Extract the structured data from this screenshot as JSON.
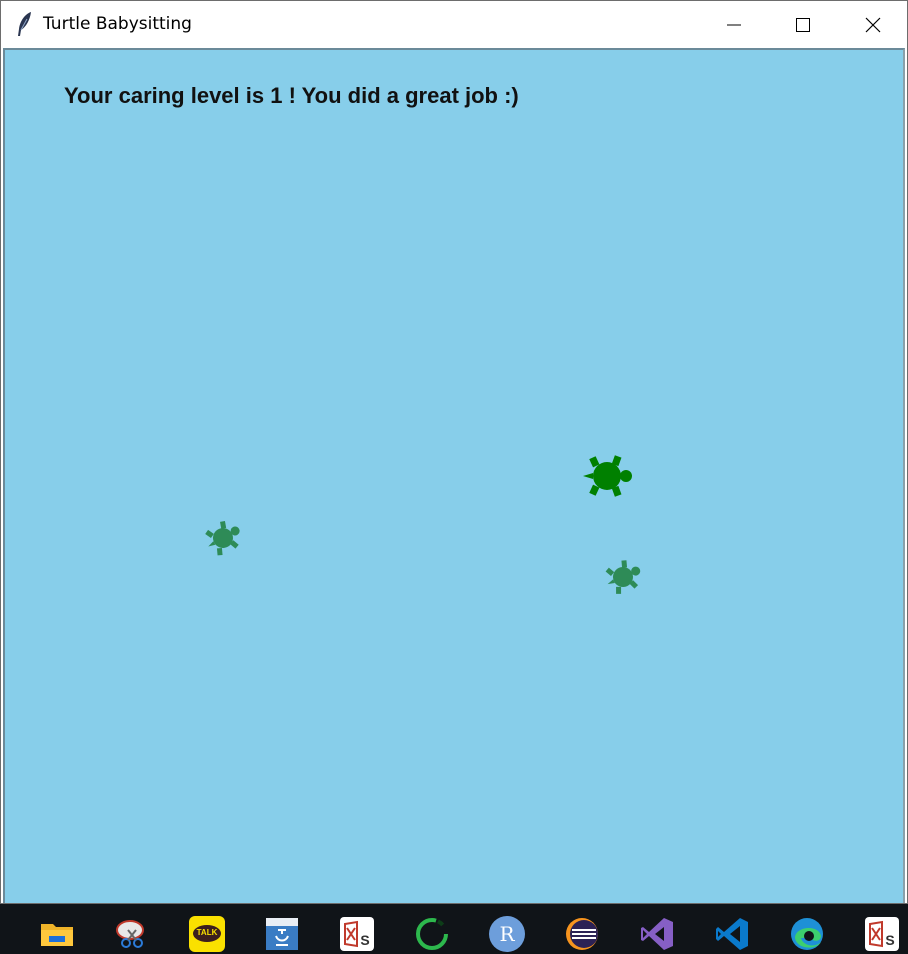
{
  "window": {
    "title": "Turtle Babysitting",
    "icon": "feather-icon",
    "controls": [
      "minimize-icon",
      "maximize-icon",
      "close-icon"
    ]
  },
  "canvas": {
    "background": "#87ceea",
    "message": "Your caring level is 1 !  You did a great job :)",
    "turtles": [
      {
        "name": "player-turtle",
        "color": "#008000"
      },
      {
        "name": "baby-turtle",
        "color": "#2e8b57"
      },
      {
        "name": "baby-turtle",
        "color": "#2e8b57"
      }
    ]
  },
  "taskbar": {
    "apps": [
      "file-explorer-icon",
      "snipping-tool-icon",
      "kakaotalk-icon",
      "hangul-word-icon",
      "spreadsheet-icon",
      "progress-ring-app-icon",
      "r-language-icon",
      "eclipse-icon",
      "visual-studio-icon",
      "vscode-icon",
      "edge-icon",
      "spreadsheet-icon-2"
    ],
    "kakao_label": "TALK",
    "r_label": "R"
  }
}
